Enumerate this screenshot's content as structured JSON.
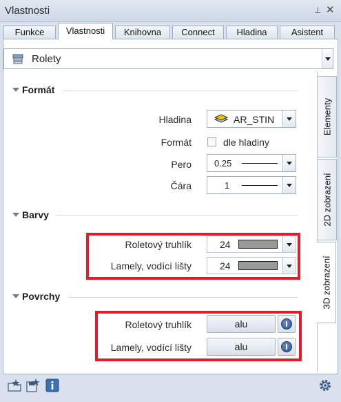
{
  "window": {
    "title": "Vlastnosti",
    "pin_glyph": "⊥",
    "close_glyph": "✕"
  },
  "tabs": [
    {
      "label": "Funkce"
    },
    {
      "label": "Vlastnosti"
    },
    {
      "label": "Knihovna"
    },
    {
      "label": "Connect"
    },
    {
      "label": "Hladina"
    },
    {
      "label": "Asistent"
    }
  ],
  "object_select": {
    "value": "Rolety",
    "icon": "shutter-icon"
  },
  "side_tabs": [
    {
      "label": "Elementy"
    },
    {
      "label": "2D zobrazení"
    },
    {
      "label": "3D zobrazení"
    }
  ],
  "format": {
    "title": "Formát",
    "layer_label": "Hladina",
    "layer_value": "AR_STIN",
    "format_label": "Formát",
    "format_checkbox_label": "dle hladiny",
    "pen_label": "Pero",
    "pen_value": "0.25",
    "line_label": "Čára",
    "line_value": "1"
  },
  "colors": {
    "title": "Barvy",
    "rows": [
      {
        "label": "Roletový truhlík",
        "value": "24",
        "swatch": "#999999"
      },
      {
        "label": "Lamely, vodící lišty",
        "value": "24",
        "swatch": "#999999"
      }
    ]
  },
  "surfaces": {
    "title": "Povrchy",
    "rows": [
      {
        "label": "Roletový truhlík",
        "value": "alu"
      },
      {
        "label": "Lamely, vodící lišty",
        "value": "alu"
      }
    ]
  },
  "highlight_color": "#e01e2b",
  "bottom_icons": [
    "favorites-open-icon",
    "favorites-save-icon",
    "info-icon",
    "settings-gear-icon"
  ]
}
